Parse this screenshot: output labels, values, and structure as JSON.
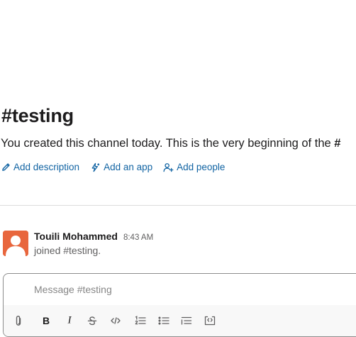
{
  "channel": {
    "title": "#testing",
    "intro_text": "You created this channel today. This is the very beginning of the ",
    "intro_hash": "#"
  },
  "actions": {
    "add_description": "Add description",
    "add_app": "Add an app",
    "add_people": "Add people"
  },
  "message": {
    "sender": "Touili Mohammed",
    "timestamp": "8:43 AM",
    "text": "joined #testing."
  },
  "composer": {
    "placeholder": "Message #testing"
  },
  "toolbar": {
    "bold_label": "B",
    "italic_label": "I"
  },
  "icons": {
    "description": "pencil-icon",
    "app": "lightning-icon",
    "people": "add-person-icon",
    "attach": "paperclip-icon",
    "strike": "strikethrough-icon",
    "code": "code-icon",
    "ordered": "ordered-list-icon",
    "bullet": "bulleted-list-icon",
    "quote": "blockquote-icon",
    "code_block": "code-block-icon"
  },
  "colors": {
    "link": "#1264a3",
    "avatar": "#e8663d",
    "text": "#1d1c1d",
    "muted": "#616061"
  }
}
